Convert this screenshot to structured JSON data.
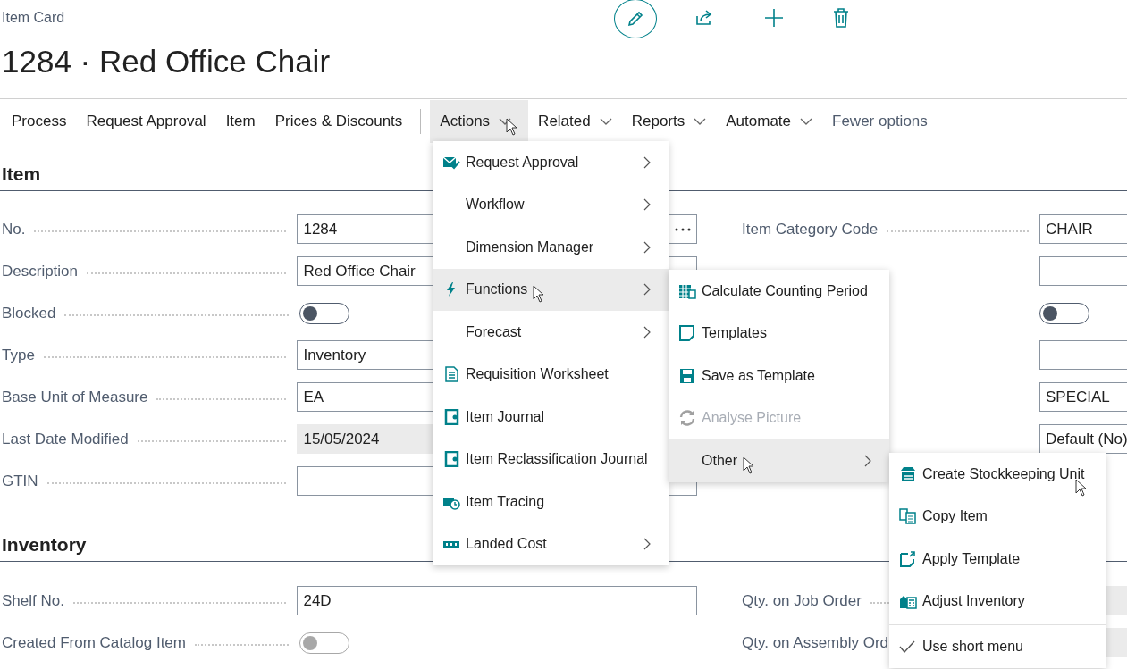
{
  "page": {
    "caption": "Item Card",
    "title": "1284 · Red Office Chair"
  },
  "action_bar": [
    {
      "kind": "tab",
      "label": "Process",
      "selected": false,
      "dropdown": false,
      "hovered": false
    },
    {
      "kind": "tab",
      "label": "Request Approval",
      "selected": false,
      "dropdown": false,
      "hovered": false
    },
    {
      "kind": "tab",
      "label": "Item",
      "selected": false,
      "dropdown": false,
      "hovered": false
    },
    {
      "kind": "tab",
      "label": "Prices & Discounts",
      "selected": false,
      "dropdown": false,
      "hovered": false
    },
    {
      "kind": "separator"
    },
    {
      "kind": "tab",
      "label": "Actions",
      "selected": true,
      "dropdown": true,
      "hovered": true
    },
    {
      "kind": "tab",
      "label": "Related",
      "selected": false,
      "dropdown": true,
      "hovered": false
    },
    {
      "kind": "tab",
      "label": "Reports",
      "selected": false,
      "dropdown": true,
      "hovered": false
    },
    {
      "kind": "tab",
      "label": "Automate",
      "selected": false,
      "dropdown": true,
      "hovered": false
    },
    {
      "kind": "link",
      "label": "Fewer options"
    }
  ],
  "sections": [
    {
      "title": "Item",
      "left": [
        {
          "label": "No.",
          "kind": "lookup",
          "value": "1284"
        },
        {
          "label": "Description",
          "kind": "text",
          "value": "Red Office Chair"
        },
        {
          "label": "Blocked",
          "kind": "toggle",
          "on": false,
          "disabled": false
        },
        {
          "label": "Type",
          "kind": "text",
          "value": "Inventory"
        },
        {
          "label": "Base Unit of Measure",
          "kind": "text",
          "value": "EA"
        },
        {
          "label": "Last Date Modified",
          "kind": "readonly",
          "value": "15/05/2024"
        },
        {
          "label": "GTIN",
          "kind": "text"
        }
      ],
      "right": [
        {
          "label": "Item Category Code",
          "kind": "text",
          "value": "CHAIR"
        },
        {
          "kind": "text"
        },
        {
          "kind": "toggle",
          "on": false,
          "disabled": false
        },
        {
          "kind": "text"
        },
        {
          "kind": "text",
          "value": "SPECIAL"
        },
        {
          "kind": "text",
          "value": "Default (No)"
        }
      ]
    },
    {
      "title": "Inventory",
      "left": [
        {
          "label": "Shelf No.",
          "kind": "text",
          "value": "24D"
        },
        {
          "label": "Created From Catalog Item",
          "kind": "toggle",
          "on": false,
          "disabled": true
        }
      ],
      "right": [
        {
          "label": "Qty. on Job Order",
          "kind": "readonly"
        },
        {
          "label": "Qty. on Assembly Ord",
          "kind": "readonly"
        }
      ]
    }
  ],
  "menus": [
    {
      "items": [
        {
          "kind": "action",
          "label": "Request Approval",
          "submenu": true,
          "highlighted": false,
          "hovered": false
        },
        {
          "kind": "action",
          "label": "Workflow",
          "submenu": true,
          "highlighted": false,
          "hovered": false
        },
        {
          "kind": "action",
          "label": "Dimension Manager",
          "submenu": true,
          "highlighted": false,
          "hovered": false
        },
        {
          "kind": "action",
          "label": "Functions",
          "submenu": true,
          "highlighted": true,
          "hovered": true
        },
        {
          "kind": "action",
          "label": "Forecast",
          "submenu": true,
          "highlighted": false,
          "hovered": false
        },
        {
          "kind": "action",
          "label": "Requisition Worksheet",
          "submenu": false,
          "highlighted": false,
          "hovered": false
        },
        {
          "kind": "action",
          "label": "Item Journal",
          "submenu": false,
          "highlighted": false,
          "hovered": false
        },
        {
          "kind": "action",
          "label": "Item Reclassification Journal",
          "submenu": false,
          "highlighted": false,
          "hovered": false
        },
        {
          "kind": "action",
          "label": "Item Tracing",
          "submenu": false,
          "highlighted": false,
          "hovered": false
        },
        {
          "kind": "action",
          "label": "Landed Cost",
          "submenu": true,
          "highlighted": false,
          "hovered": false
        }
      ]
    },
    {
      "items": [
        {
          "kind": "action",
          "label": "Calculate Counting Period",
          "submenu": false,
          "highlighted": false,
          "hovered": false,
          "disabled": false
        },
        {
          "kind": "action",
          "label": "Templates",
          "submenu": false,
          "highlighted": false,
          "hovered": false,
          "disabled": false
        },
        {
          "kind": "action",
          "label": "Save as Template",
          "submenu": false,
          "highlighted": false,
          "hovered": false,
          "disabled": false
        },
        {
          "kind": "action",
          "label": "Analyse Picture",
          "submenu": false,
          "highlighted": false,
          "hovered": false,
          "disabled": true
        },
        {
          "kind": "action",
          "label": "Other",
          "submenu": true,
          "highlighted": true,
          "hovered": true,
          "disabled": false
        }
      ]
    },
    {
      "items": [
        {
          "kind": "action",
          "label": "Create Stockkeeping Unit",
          "submenu": false,
          "highlighted": false,
          "hovered": true
        },
        {
          "kind": "action",
          "label": "Copy Item",
          "submenu": false,
          "highlighted": false,
          "hovered": false
        },
        {
          "kind": "action",
          "label": "Apply Template",
          "submenu": false,
          "highlighted": false,
          "hovered": false
        },
        {
          "kind": "action",
          "label": "Adjust Inventory",
          "submenu": false,
          "highlighted": false,
          "hovered": false
        },
        {
          "kind": "check",
          "label": "Use short menu",
          "checked": true
        }
      ]
    }
  ]
}
